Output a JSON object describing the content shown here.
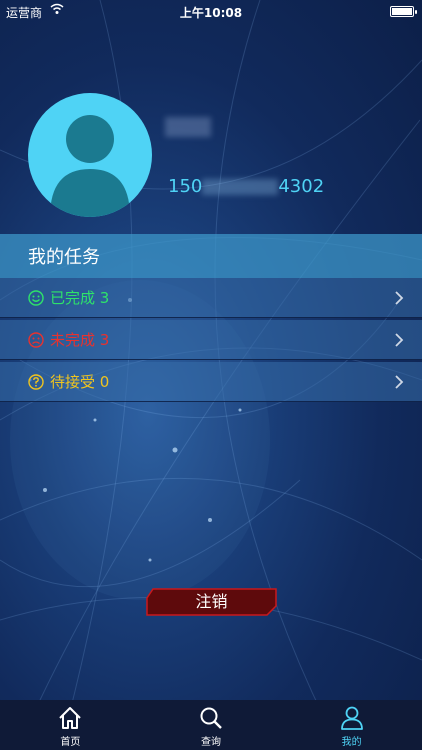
{
  "status_bar": {
    "carrier": "运营商",
    "time": "上午10:08"
  },
  "profile": {
    "phone_prefix": "150",
    "phone_suffix": "4302"
  },
  "tasks": {
    "header": "我的任务",
    "items": [
      {
        "label": "已完成 3",
        "color": "#2ee36a",
        "icon": "smile-icon"
      },
      {
        "label": "未完成 3",
        "color": "#e8322e",
        "icon": "frown-icon"
      },
      {
        "label": "待接受 0",
        "color": "#f0c41e",
        "icon": "question-icon"
      }
    ]
  },
  "logout_label": "注销",
  "tabbar": [
    {
      "label": "首页",
      "icon": "home-icon"
    },
    {
      "label": "查询",
      "icon": "search-icon"
    },
    {
      "label": "我的",
      "icon": "user-icon",
      "active": true
    }
  ]
}
